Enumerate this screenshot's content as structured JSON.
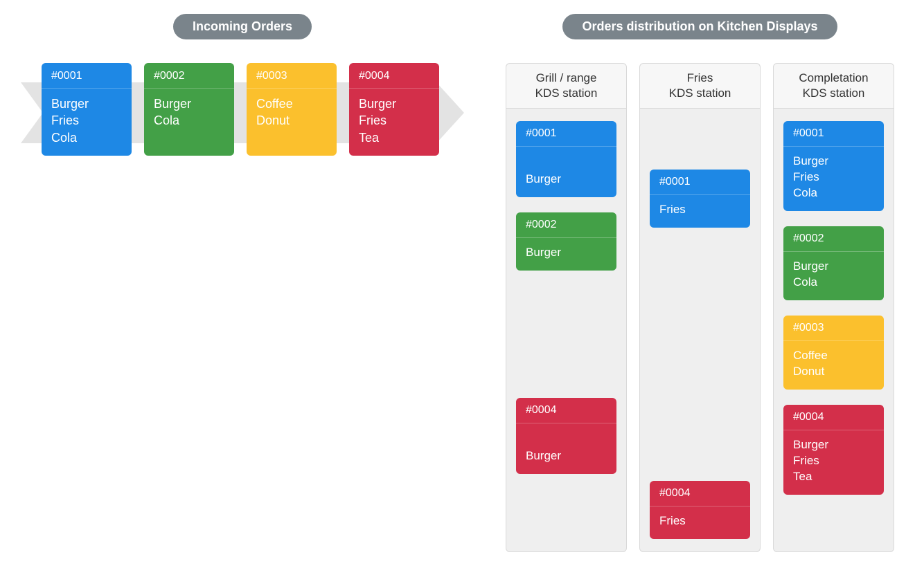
{
  "colors": {
    "blue": "#1e88e5",
    "green": "#43a047",
    "yellow": "#fbc02d",
    "red": "#d32f4a"
  },
  "incoming": {
    "title": "Incoming Orders",
    "orders": [
      {
        "id": "#0001",
        "color": "blue",
        "items": [
          "Burger",
          "Fries",
          "Cola"
        ]
      },
      {
        "id": "#0002",
        "color": "green",
        "items": [
          "Burger",
          "Cola"
        ]
      },
      {
        "id": "#0003",
        "color": "yellow",
        "items": [
          "Coffee",
          "Donut"
        ]
      },
      {
        "id": "#0004",
        "color": "red",
        "items": [
          "Burger",
          "Fries",
          "Tea"
        ]
      }
    ]
  },
  "distribution": {
    "title": "Orders distribution on Kitchen Displays",
    "stations": [
      {
        "name": "Grill / range\nKDS station",
        "cards": [
          {
            "id": "#0001",
            "color": "blue",
            "items": [
              "Burger"
            ],
            "tall": true
          },
          {
            "id": "#0002",
            "color": "green",
            "items": [
              "Burger"
            ]
          },
          {
            "gap": 140
          },
          {
            "id": "#0004",
            "color": "red",
            "items": [
              "Burger"
            ],
            "tall": true
          }
        ]
      },
      {
        "name": "Fries\nKDS station",
        "cards": [
          {
            "gap": 48
          },
          {
            "id": "#0001",
            "color": "blue",
            "items": [
              "Fries"
            ]
          },
          {
            "gap": 322
          },
          {
            "id": "#0004",
            "color": "red",
            "items": [
              "Fries"
            ]
          }
        ]
      },
      {
        "name": "Completation\nKDS station",
        "cards": [
          {
            "id": "#0001",
            "color": "blue",
            "items": [
              "Burger",
              "Fries",
              "Cola"
            ]
          },
          {
            "id": "#0002",
            "color": "green",
            "items": [
              "Burger",
              "Cola"
            ]
          },
          {
            "id": "#0003",
            "color": "yellow",
            "items": [
              "Coffee",
              "Donut"
            ]
          },
          {
            "id": "#0004",
            "color": "red",
            "items": [
              "Burger",
              "Fries",
              "Tea"
            ]
          }
        ]
      }
    ]
  }
}
